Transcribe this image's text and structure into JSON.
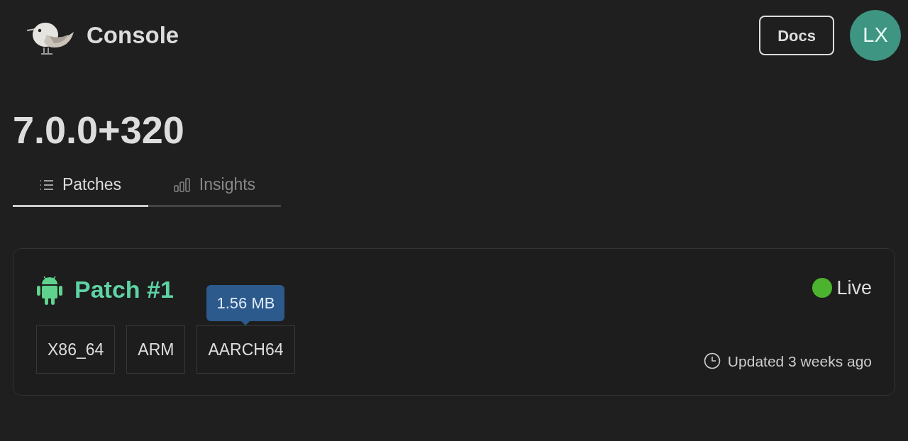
{
  "header": {
    "brand": "Console",
    "docs_button": "Docs",
    "avatar": "LX"
  },
  "title": "7.0.0+320",
  "tabs": [
    {
      "label": "Patches",
      "selected": true
    },
    {
      "label": "Insights",
      "selected": false
    }
  ],
  "patch": {
    "name": "Patch #1",
    "status": {
      "label": "Live",
      "color": "#4cb32f"
    },
    "archs": [
      {
        "label": "X86_64"
      },
      {
        "label": "ARM"
      },
      {
        "label": "AARCH64",
        "tooltip": "1.56 MB"
      }
    ],
    "updated": "Updated 3 weeks ago"
  }
}
